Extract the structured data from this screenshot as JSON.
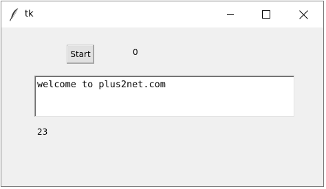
{
  "window": {
    "title": "tk",
    "app_icon": "feather-icon",
    "controls": [
      "minimize-icon",
      "maximize-icon",
      "close-icon"
    ]
  },
  "main": {
    "start_button_label": "Start",
    "counter_value": "0",
    "text_content": "welcome to plus2net.com",
    "length_value": "23"
  }
}
